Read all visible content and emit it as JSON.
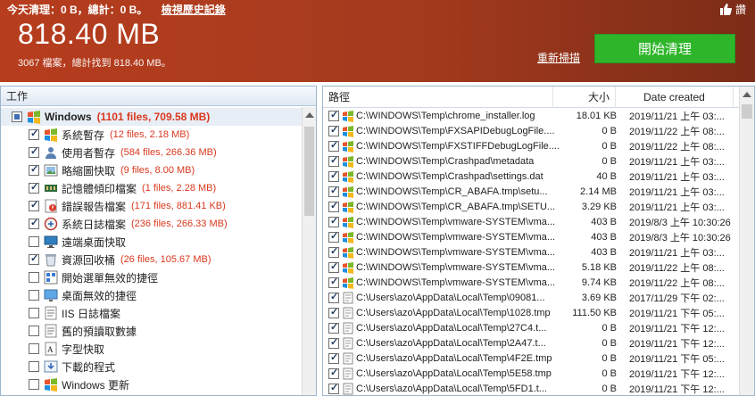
{
  "header": {
    "today_label": "今天清理：0 B，總計：0 B。",
    "history_link": "檢視歷史記錄",
    "total_size": "818.40 MB",
    "summary": "3067 檔案，總計找到 818.40 MB。",
    "like_label": "讚",
    "rescan_label": "重新掃描",
    "start_label": "開始清理"
  },
  "left": {
    "header": "工作",
    "group": {
      "label": "Windows",
      "stats": "(1101 files, 709.58 MB)"
    },
    "items": [
      {
        "label": "系統暫存",
        "stats": "(12 files, 2.18 MB)",
        "checked": true,
        "icon": "temp-icon"
      },
      {
        "label": "使用者暫存",
        "stats": "(584 files, 266.36 MB)",
        "checked": true,
        "icon": "user-temp-icon"
      },
      {
        "label": "略縮圖快取",
        "stats": "(9 files, 8.00 MB)",
        "checked": true,
        "icon": "thumbnail-icon"
      },
      {
        "label": "記憶體傾印檔案",
        "stats": "(1 files, 2.28 MB)",
        "checked": true,
        "icon": "memory-dump-icon"
      },
      {
        "label": "錯誤報告檔案",
        "stats": "(171 files, 881.41 KB)",
        "checked": true,
        "icon": "error-report-icon"
      },
      {
        "label": "系統日誌檔案",
        "stats": "(236 files, 266.33 MB)",
        "checked": true,
        "icon": "log-icon"
      },
      {
        "label": "遠端桌面快取",
        "stats": "",
        "checked": false,
        "icon": "remote-desktop-icon"
      },
      {
        "label": "資源回收桶",
        "stats": "(26 files, 105.67 MB)",
        "checked": true,
        "icon": "recycle-bin-icon"
      },
      {
        "label": "開始選單無效的捷徑",
        "stats": "",
        "checked": false,
        "icon": "start-menu-icon"
      },
      {
        "label": "桌面無效的捷徑",
        "stats": "",
        "checked": false,
        "icon": "desktop-icon"
      },
      {
        "label": "IIS 日誌檔案",
        "stats": "",
        "checked": false,
        "icon": "iis-icon"
      },
      {
        "label": "舊的預讀取數據",
        "stats": "",
        "checked": false,
        "icon": "prefetch-icon"
      },
      {
        "label": "字型快取",
        "stats": "",
        "checked": false,
        "icon": "font-cache-icon"
      },
      {
        "label": "下載的程式",
        "stats": "",
        "checked": false,
        "icon": "download-icon"
      },
      {
        "label": "Windows 更新",
        "stats": "",
        "checked": false,
        "icon": "windows-update-icon"
      }
    ]
  },
  "right": {
    "columns": {
      "path": "路徑",
      "size": "大小",
      "date": "Date created"
    },
    "rows": [
      {
        "path": "C:\\WINDOWS\\Temp\\chrome_installer.log",
        "size": "18.01 KB",
        "date": "2019/11/21 上午 03:..."
      },
      {
        "path": "C:\\WINDOWS\\Temp\\FXSAPIDebugLogFile....",
        "size": "0 B",
        "date": "2019/11/22 上午 08:..."
      },
      {
        "path": "C:\\WINDOWS\\Temp\\FXSTIFFDebugLogFile....",
        "size": "0 B",
        "date": "2019/11/22 上午 08:..."
      },
      {
        "path": "C:\\WINDOWS\\Temp\\Crashpad\\metadata",
        "size": "0 B",
        "date": "2019/11/21 上午 03:..."
      },
      {
        "path": "C:\\WINDOWS\\Temp\\Crashpad\\settings.dat",
        "size": "40 B",
        "date": "2019/11/21 上午 03:..."
      },
      {
        "path": "C:\\WINDOWS\\Temp\\CR_ABAFA.tmp\\setu...",
        "size": "2.14 MB",
        "date": "2019/11/21 上午 03:..."
      },
      {
        "path": "C:\\WINDOWS\\Temp\\CR_ABAFA.tmp\\SETU...",
        "size": "3.29 KB",
        "date": "2019/11/21 上午 03:..."
      },
      {
        "path": "C:\\WINDOWS\\Temp\\vmware-SYSTEM\\vma...",
        "size": "403 B",
        "date": "2019/8/3 上午 10:30:26"
      },
      {
        "path": "C:\\WINDOWS\\Temp\\vmware-SYSTEM\\vma...",
        "size": "403 B",
        "date": "2019/8/3 上午 10:30:26"
      },
      {
        "path": "C:\\WINDOWS\\Temp\\vmware-SYSTEM\\vma...",
        "size": "403 B",
        "date": "2019/11/21 上午 03:..."
      },
      {
        "path": "C:\\WINDOWS\\Temp\\vmware-SYSTEM\\vma...",
        "size": "5.18 KB",
        "date": "2019/11/22 上午 08:..."
      },
      {
        "path": "C:\\WINDOWS\\Temp\\vmware-SYSTEM\\vma...",
        "size": "9.74 KB",
        "date": "2019/11/22 上午 08:..."
      },
      {
        "path": "C:\\Users\\azo\\AppData\\Local\\Temp\\09081...",
        "size": "3.69 KB",
        "date": "2017/11/29 下午 02:..."
      },
      {
        "path": "C:\\Users\\azo\\AppData\\Local\\Temp\\1028.tmp",
        "size": "111.50 KB",
        "date": "2019/11/21 下午 05:..."
      },
      {
        "path": "C:\\Users\\azo\\AppData\\Local\\Temp\\27C4.t...",
        "size": "0 B",
        "date": "2019/11/21 下午 12:..."
      },
      {
        "path": "C:\\Users\\azo\\AppData\\Local\\Temp\\2A47.t...",
        "size": "0 B",
        "date": "2019/11/21 下午 12:..."
      },
      {
        "path": "C:\\Users\\azo\\AppData\\Local\\Temp\\4F2E.tmp",
        "size": "0 B",
        "date": "2019/11/21 下午 05:..."
      },
      {
        "path": "C:\\Users\\azo\\AppData\\Local\\Temp\\5E58.tmp",
        "size": "0 B",
        "date": "2019/11/21 下午 12:..."
      },
      {
        "path": "C:\\Users\\azo\\AppData\\Local\\Temp\\5FD1.t...",
        "size": "0 B",
        "date": "2019/11/21 下午 12:..."
      }
    ]
  },
  "colors": {
    "header": "#a43a1e",
    "start_button": "#2fb52a",
    "stats": "#d9381e"
  }
}
